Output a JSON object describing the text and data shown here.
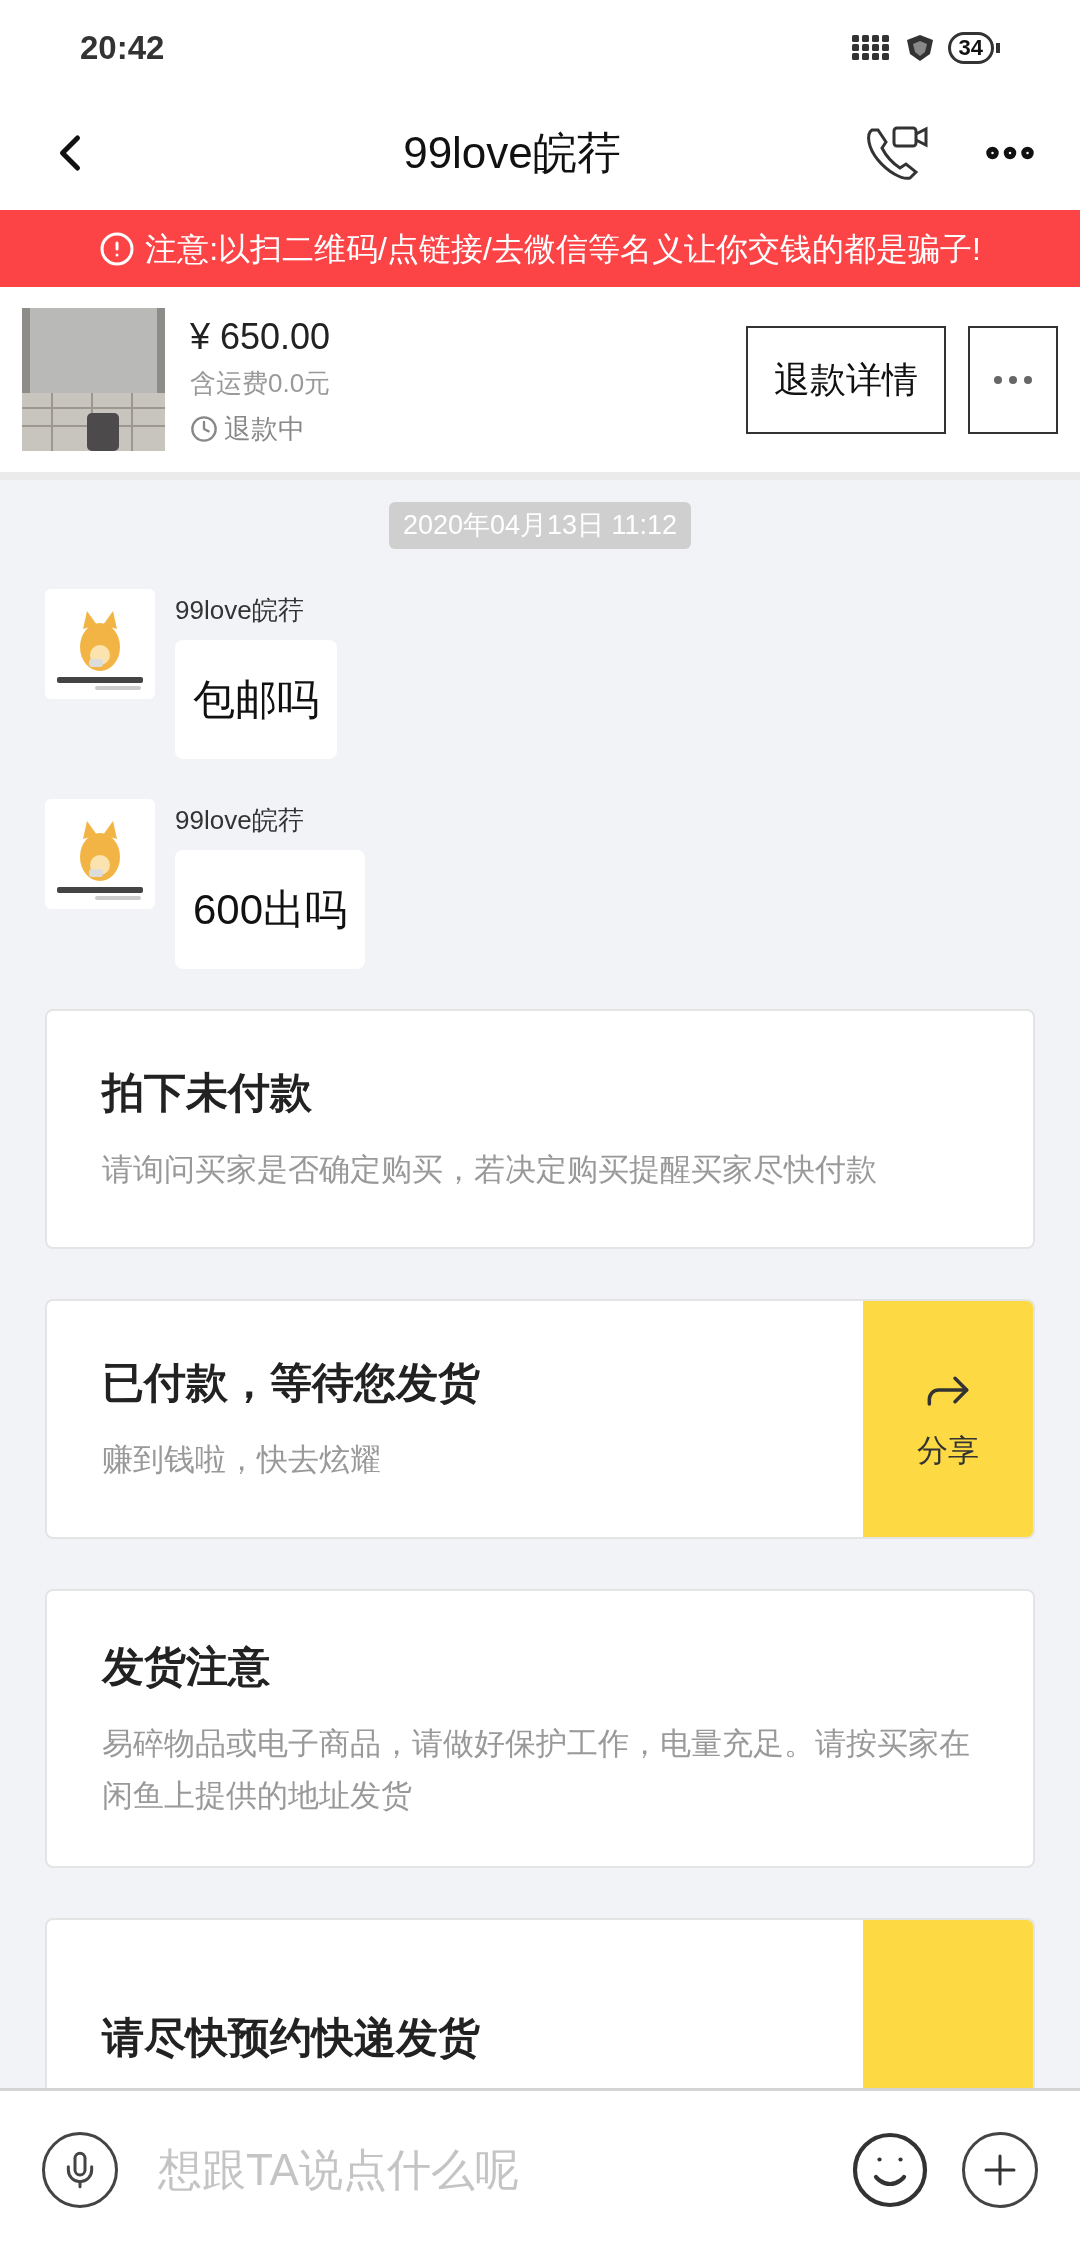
{
  "status_bar": {
    "time": "20:42",
    "battery": "34"
  },
  "header": {
    "title": "99love皖荇"
  },
  "warning": {
    "text": "注意:以扫二维码/点链接/去微信等名义让你交钱的都是骗子!"
  },
  "product": {
    "price": "¥ 650.00",
    "shipping": "含运费0.0元",
    "status": "退款中",
    "button": "退款详情"
  },
  "chat": {
    "date": "2020年04月13日 11:12",
    "messages": [
      {
        "sender": "99love皖荇",
        "text": "包邮吗"
      },
      {
        "sender": "99love皖荇",
        "text": "600出吗"
      }
    ]
  },
  "cards": [
    {
      "title": "拍下未付款",
      "description": "请询问买家是否确定购买，若决定购买提醒买家尽快付款",
      "accent": false
    },
    {
      "title": "已付款，等待您发货",
      "description": "赚到钱啦，快去炫耀",
      "accent": true,
      "action_label": "分享"
    },
    {
      "title": "发货注意",
      "description": "易碎物品或电子商品，请做好保护工作，电量充足。请按买家在闲鱼上提供的地址发货",
      "accent": false
    },
    {
      "title": "请尽快预约快递发货",
      "accent": true
    }
  ],
  "input": {
    "placeholder": "想跟TA说点什么呢"
  }
}
